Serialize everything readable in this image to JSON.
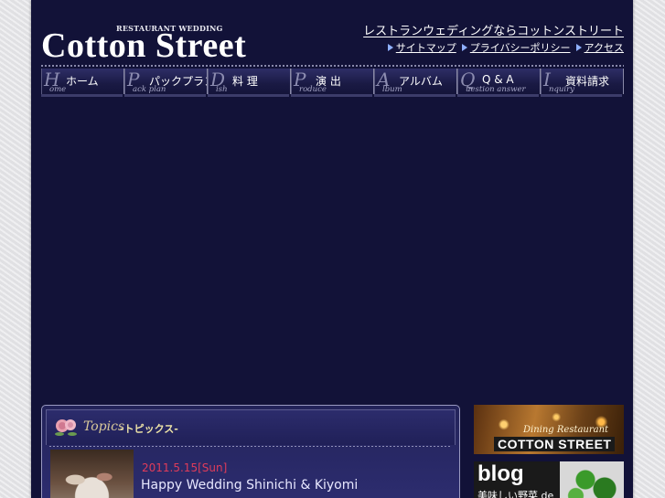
{
  "header": {
    "logo_small": "RESTAURANT WEDDING",
    "logo": "Cotton Street",
    "tagline": "レストランウェディングならコットンストリート",
    "links": [
      "サイトマップ",
      "プライバシーポリシー",
      "アクセス"
    ]
  },
  "nav": [
    {
      "letter": "H",
      "sub": "ome",
      "label": "ホーム"
    },
    {
      "letter": "P",
      "sub": "ack plan",
      "label": "パックプラン"
    },
    {
      "letter": "D",
      "sub": "ish",
      "label": "料 理"
    },
    {
      "letter": "P",
      "sub": "roduce",
      "label": "演 出"
    },
    {
      "letter": "A",
      "sub": "lbum",
      "label": "アルバム"
    },
    {
      "letter": "Q",
      "sub": "uestion answer",
      "label": "Q & A"
    },
    {
      "letter": "I",
      "sub": "nquiry",
      "label": "資料請求"
    }
  ],
  "topics": {
    "script": "Topics",
    "jp": "-トピックス-",
    "items": [
      {
        "date": "2011.5.15[Sun]",
        "title": "Happy Wedding Shinichi & Kiyomi"
      }
    ]
  },
  "banners": {
    "restaurant_script": "Dining Restaurant",
    "restaurant_brand": "COTTON STREET",
    "blog": "blog",
    "blog_sub": "美味しい野菜 de"
  },
  "colors": {
    "background": "#121238",
    "accent_date": "#e03c5a",
    "topics_heading": "#f0e6a8"
  }
}
